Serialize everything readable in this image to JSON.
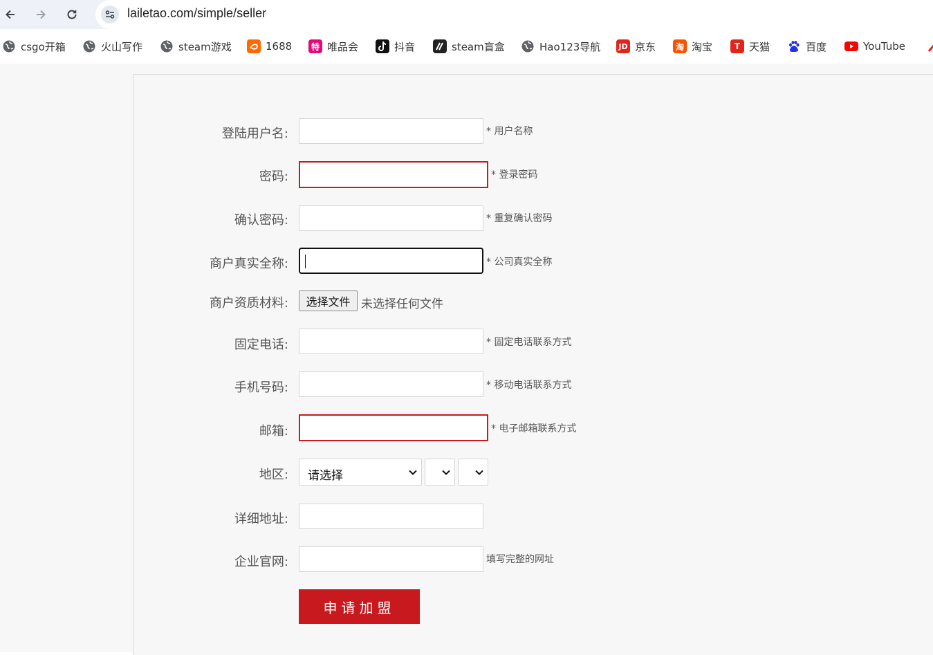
{
  "browser": {
    "url": "lailetao.com/simple/seller",
    "bookmarks": [
      {
        "label": "csgo开箱",
        "icon": "globe-icon"
      },
      {
        "label": "火山写作",
        "icon": "globe-icon"
      },
      {
        "label": "steam游戏",
        "icon": "globe-icon"
      },
      {
        "label": "1688",
        "icon": "1688-logo-icon",
        "color": "#ff6a00"
      },
      {
        "label": "唯品会",
        "icon": "vip-logo-icon",
        "color": "#e4087a",
        "glyph": "特"
      },
      {
        "label": "抖音",
        "icon": "douyin-logo-icon",
        "color": "#111111"
      },
      {
        "label": "steam盲盒",
        "icon": "steam-box-logo-icon",
        "color": "#222222"
      },
      {
        "label": "Hao123导航",
        "icon": "globe-icon"
      },
      {
        "label": "京东",
        "icon": "jd-logo-icon",
        "color": "#e1251b",
        "glyph": "JD"
      },
      {
        "label": "淘宝",
        "icon": "taobao-logo-icon",
        "color": "#ff5000",
        "glyph": "淘"
      },
      {
        "label": "天猫",
        "icon": "tmall-logo-icon",
        "color": "#e1251b",
        "glyph": "T"
      },
      {
        "label": "百度",
        "icon": "baidu-logo-icon",
        "color": "#2932e1"
      },
      {
        "label": "YouTube",
        "icon": "youtube-logo-icon",
        "color": "#ff0000"
      }
    ]
  },
  "form": {
    "username": {
      "label": "登陆用户名:",
      "hint": "* 用户名称",
      "value": ""
    },
    "password": {
      "label": "密码:",
      "hint": "* 登录密码",
      "value": ""
    },
    "confirm_password": {
      "label": "确认密码:",
      "hint": "* 重复确认密码",
      "value": ""
    },
    "company_name": {
      "label": "商户真实全称:",
      "hint": "* 公司真实全称",
      "value": ""
    },
    "qualification": {
      "label": "商户资质材料:",
      "button": "选择文件",
      "status": "未选择任何文件"
    },
    "phone": {
      "label": "固定电话:",
      "hint": "* 固定电话联系方式",
      "value": ""
    },
    "mobile": {
      "label": "手机号码:",
      "hint": "* 移动电话联系方式",
      "value": ""
    },
    "email": {
      "label": "邮箱:",
      "hint": "* 电子邮箱联系方式",
      "value": ""
    },
    "region": {
      "label": "地区:",
      "province": "请选择",
      "city": "",
      "district": ""
    },
    "address": {
      "label": "详细地址:",
      "value": ""
    },
    "website": {
      "label": "企业官网:",
      "hint": "填写完整的网址",
      "value": ""
    },
    "submit_label": "申请加盟"
  },
  "colors": {
    "accent": "#c8191f",
    "error_border": "#c8191f"
  }
}
